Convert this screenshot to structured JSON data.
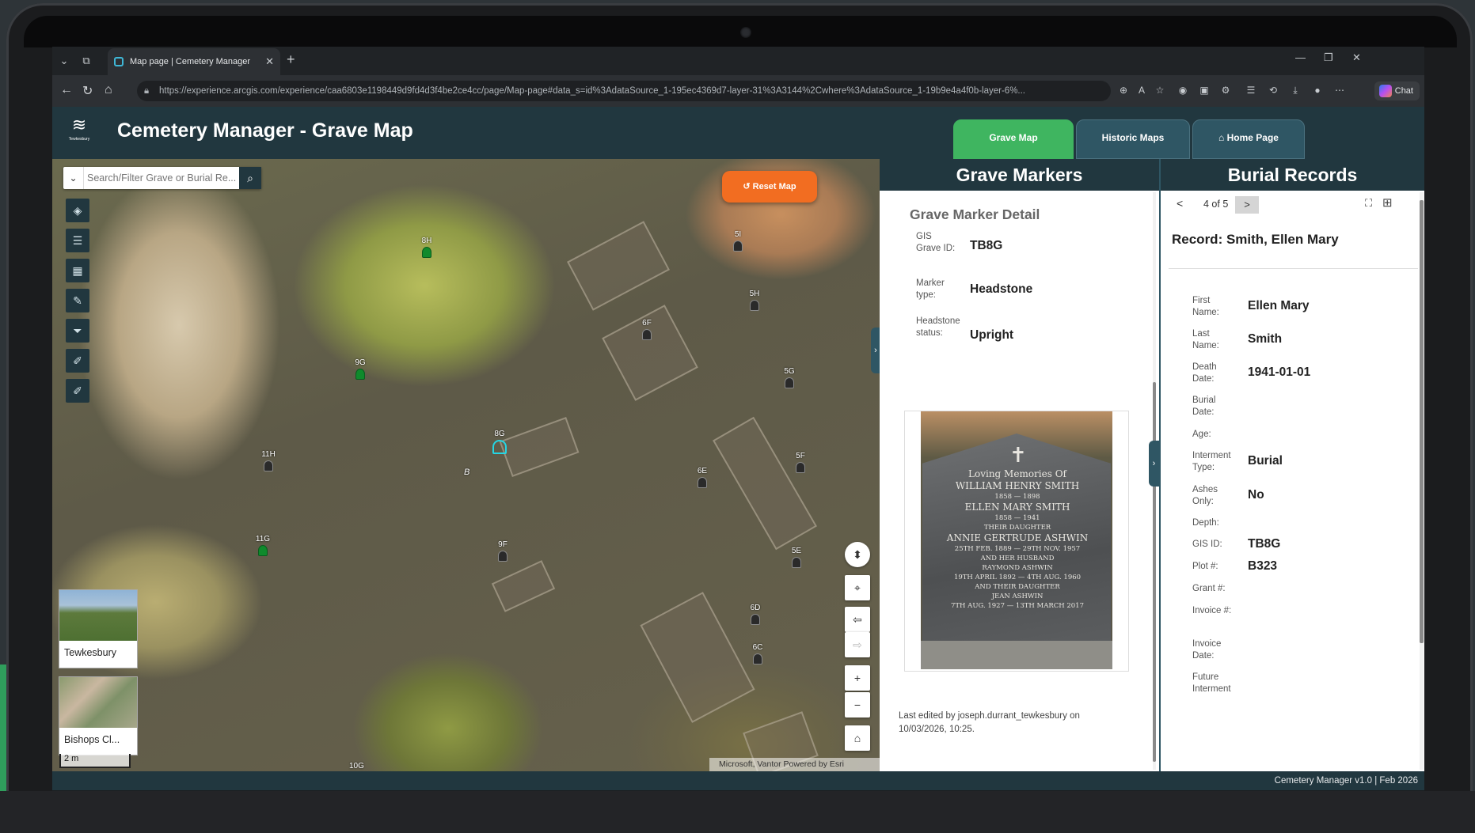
{
  "browser": {
    "tab_title": "Map page | Cemetery Manager",
    "url": "https://experience.arcgis.com/experience/caa6803e1198449d9fd4d3f4be2ce4cc/page/Map-page#data_s=id%3AdataSource_1-195ec4369d7-layer-31%3A3144%2Cwhere%3AdataSource_1-19b9e4a4f0b-layer-6%...",
    "chat_label": "Chat"
  },
  "app": {
    "title": "Cemetery Manager - Grave Map",
    "logo_text": "Tewkesbury",
    "nav_tabs": [
      "Grave Map",
      "Historic Maps",
      "Home Page"
    ]
  },
  "map": {
    "search_placeholder": "Search/Filter Grave or Burial Re...",
    "reset_label": "Reset Map",
    "basemaps": [
      "Tewkesbury",
      "Bishops Cl..."
    ],
    "scale_label": "2 m",
    "attribution": "Microsoft, Vantor  Powered by Esri",
    "area_label": "B",
    "edge_label": "10G",
    "markers": [
      {
        "id": "8H",
        "kind": "tree"
      },
      {
        "id": "5I",
        "kind": "stone"
      },
      {
        "id": "5H",
        "kind": "stone"
      },
      {
        "id": "6F",
        "kind": "stone"
      },
      {
        "id": "9G",
        "kind": "tree"
      },
      {
        "id": "5G",
        "kind": "stone"
      },
      {
        "id": "8G",
        "kind": "selected"
      },
      {
        "id": "11H",
        "kind": "stone"
      },
      {
        "id": "6E",
        "kind": "stone"
      },
      {
        "id": "5F",
        "kind": "stone"
      },
      {
        "id": "11G",
        "kind": "tree"
      },
      {
        "id": "9F",
        "kind": "stone"
      },
      {
        "id": "5E",
        "kind": "stone"
      },
      {
        "id": "6D",
        "kind": "stone"
      },
      {
        "id": "6C",
        "kind": "stone"
      }
    ]
  },
  "grave_markers": {
    "header": "Grave Markers",
    "subtitle": "Grave Marker Detail",
    "fields": [
      {
        "label": "GIS Grave ID:",
        "value": "TB8G"
      },
      {
        "label": "Marker type:",
        "value": "Headstone"
      },
      {
        "label": "Headstone status:",
        "value": "Upright"
      }
    ],
    "photo_inscription": [
      "Loving Memories Of",
      "WILLIAM HENRY SMITH",
      "1858 — 1898",
      "ELLEN MARY SMITH",
      "1858 — 1941",
      "THEIR DAUGHTER",
      "ANNIE GERTRUDE ASHWIN",
      "25TH FEB. 1889 — 29TH NOV. 1957",
      "AND HER HUSBAND",
      "RAYMOND ASHWIN",
      "19TH APRIL 1892 — 4TH AUG. 1960",
      "AND THEIR DAUGHTER",
      "JEAN ASHWIN",
      "7TH AUG. 1927 — 13TH MARCH 2017"
    ],
    "last_edited": "Last edited by joseph.durrant_tewkesbury on 10/03/2026, 10:25."
  },
  "burial_records": {
    "header": "Burial Records",
    "pager": "4 of 5",
    "record_title": "Record: Smith, Ellen Mary",
    "fields": [
      {
        "label": "First Name:",
        "value": "Ellen Mary"
      },
      {
        "label": "Last Name:",
        "value": "Smith"
      },
      {
        "label": "Death Date:",
        "value": "1941-01-01"
      },
      {
        "label": "Burial Date:",
        "value": ""
      },
      {
        "label": "Age:",
        "value": ""
      },
      {
        "label": "Interment Type:",
        "value": "Burial"
      },
      {
        "label": "Ashes Only:",
        "value": "No"
      },
      {
        "label": "Depth:",
        "value": ""
      },
      {
        "label": "GIS ID:",
        "value": "TB8G"
      },
      {
        "label": "Plot #:",
        "value": "B323"
      },
      {
        "label": "Grant #:",
        "value": ""
      },
      {
        "label": "Invoice #:",
        "value": ""
      },
      {
        "label": "Invoice Date:",
        "value": ""
      },
      {
        "label": "Future Interment",
        "value": ""
      }
    ]
  },
  "footer": "Cemetery Manager v1.0 | Feb 2026",
  "colors": {
    "header": "#21373f",
    "active_tab": "#3fb560",
    "reset": "#f26d21",
    "selected_marker": "#24d6e4"
  }
}
